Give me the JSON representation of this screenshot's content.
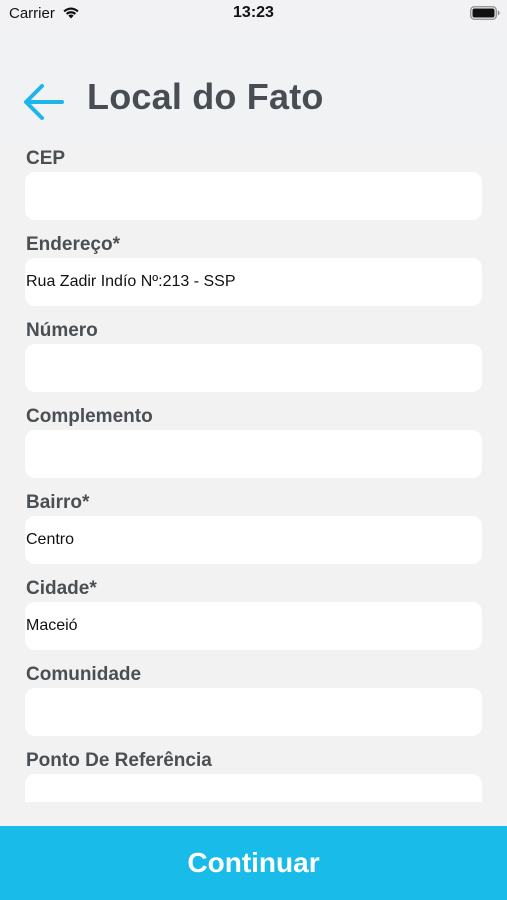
{
  "status_bar": {
    "carrier": "Carrier",
    "time": "13:23",
    "wifi_icon": "wifi-icon",
    "battery_icon": "battery-full-icon"
  },
  "header": {
    "back_icon": "arrow-left-icon",
    "title": "Local do Fato",
    "accent_color": "#1fb5ea"
  },
  "form": {
    "fields": [
      {
        "label": "CEP",
        "value": ""
      },
      {
        "label": "Endereço*",
        "value": "Rua Zadir Indío Nº:213 - SSP"
      },
      {
        "label": "Número",
        "value": ""
      },
      {
        "label": "Complemento",
        "value": ""
      },
      {
        "label": "Bairro*",
        "value": "Centro"
      },
      {
        "label": "Cidade*",
        "value": "Maceió"
      },
      {
        "label": "Comunidade",
        "value": ""
      },
      {
        "label": "Ponto De Referência",
        "value": ""
      }
    ]
  },
  "footer": {
    "continue_label": "Continuar",
    "button_color": "#19bce9"
  }
}
